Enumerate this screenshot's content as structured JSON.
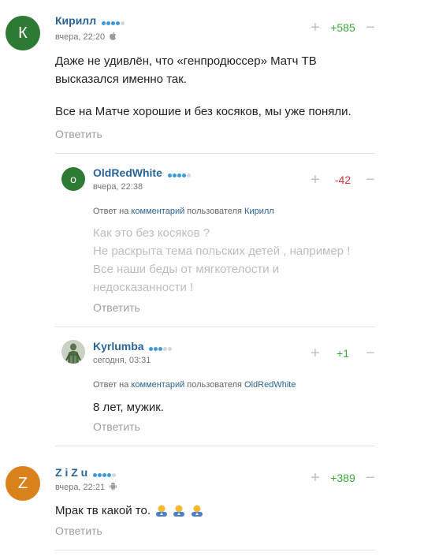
{
  "comments": [
    {
      "author": "Кирилл",
      "avatar_letter": "К",
      "avatar_color": "#2d7a35",
      "time": "вчера, 22:20",
      "device_icon": "apple-icon",
      "score": "+585",
      "text_lines": [
        "Даже не удивлён, что «генпродюссер» Матч ТВ",
        "высказался именно так.",
        "",
        "Все на Матче хорошие и без косяков, мы уже поняли."
      ],
      "reply_label": "Ответить"
    },
    {
      "author": "OldRedWhite",
      "avatar_letter": "o",
      "avatar_color": "#2d7a35",
      "time": "вчера, 22:38",
      "score": "-42",
      "reply_to": {
        "prefix": "Ответ на",
        "link": "комментарий",
        "middle": "пользователя",
        "user": "Кирилл"
      },
      "text_lines": [
        "Как это без косяков ?",
        "Не раскрыта тема польских детей , например !",
        "Все наши беды от мягкотелости и",
        "недосказанности !"
      ],
      "reply_label": "Ответить"
    },
    {
      "author": "Kyrlumba",
      "time": "сегодня, 03:31",
      "score": "+1",
      "reply_to": {
        "prefix": "Ответ на",
        "link": "комментарий",
        "middle": "пользователя",
        "user": "OldRedWhite"
      },
      "text": "8 лет, мужик.",
      "reply_label": "Ответить"
    },
    {
      "author": "Z i Z u",
      "avatar_letter": "Z",
      "avatar_color": "#d9811a",
      "time": "вчера, 22:21",
      "device_icon": "android-icon",
      "score": "+389",
      "text": "Мрак тв какой то.",
      "emoji_icons": [
        "person-emoji-icon",
        "person-emoji-icon",
        "person-emoji-icon"
      ],
      "reply_label": "Ответить"
    }
  ]
}
